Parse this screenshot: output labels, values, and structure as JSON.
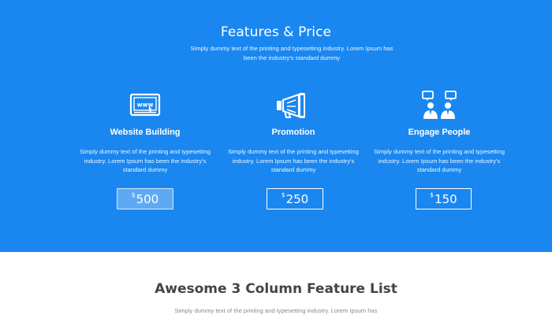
{
  "features": {
    "title": "Features & Price",
    "subtitle": "Simply dummy text of the printing and typesetting industry. Lorem Ipsum has been the industry's standard dummy",
    "columns": [
      {
        "icon": "www-monitor-icon",
        "title": "Website Building",
        "description": "Simply dummy text of the printing and typesetting industry. Lorem Ipsum has been the industry's standard dummy",
        "price_currency": "$",
        "price_amount": "500",
        "active": true
      },
      {
        "icon": "megaphone-icon",
        "title": "Promotion",
        "description": "Simply dummy text of the printing and typesetting industry. Lorem Ipsum has been the industry's standard dummy",
        "price_currency": "$",
        "price_amount": "250",
        "active": false
      },
      {
        "icon": "people-chat-icon",
        "title": "Engage People",
        "description": "Simply dummy text of the printing and typesetting industry. Lorem Ipsum has been the industry's standard dummy",
        "price_currency": "$",
        "price_amount": "150",
        "active": false
      }
    ]
  },
  "feature_list": {
    "title": "Awesome 3 Column Feature List",
    "subtitle": "Simply dummy text of the printing and typesetting industry. Lorem Ipsum has"
  },
  "colors": {
    "brand_blue": "#1a87f0",
    "active_price_bg": "#5fa9f4",
    "white": "#ffffff"
  }
}
